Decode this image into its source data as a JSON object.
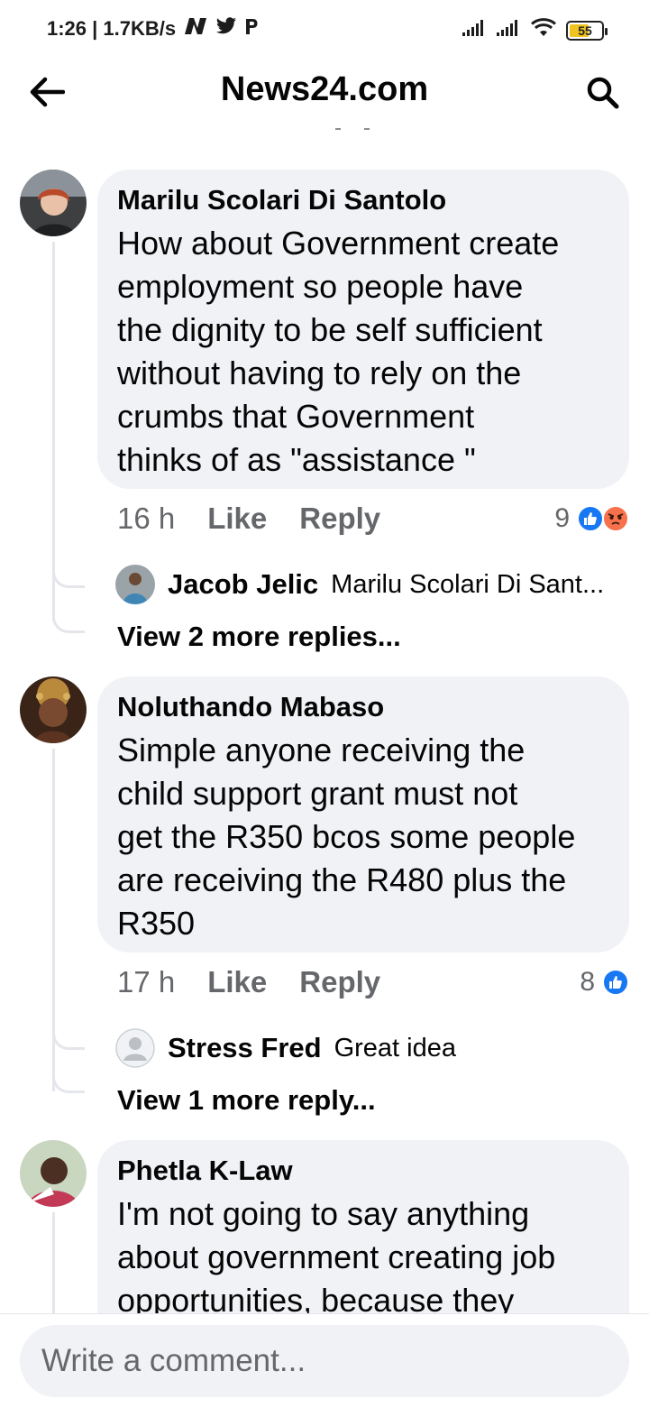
{
  "status_bar": {
    "time_speed": "1:26 | 1.7KB/s",
    "battery": "55",
    "app_icons": [
      "n-icon",
      "twitter-icon",
      "p-icon"
    ]
  },
  "header": {
    "title": "News24.com",
    "back_icon": "back-arrow-icon",
    "search_icon": "search-icon"
  },
  "comments": [
    {
      "author": "Marilu Scolari Di Santolo",
      "text": "How about Government  create\nemployment  so people have\nthe dignity to be self sufficient\nwithout  having to rely on the\ncrumbs that Government\nthinks of  as \"assistance \"",
      "time": "16 h",
      "like": "Like",
      "reply": "Reply",
      "reaction_count": "9",
      "reactions": [
        "like",
        "angry"
      ],
      "reply_preview": {
        "author": "Jacob Jelic",
        "text": "Marilu Scolari Di Sant..."
      },
      "more_replies": "View 2 more replies..."
    },
    {
      "author": "Noluthando Mabaso",
      "text": "Simple anyone receiving the\nchild support grant must not\nget the R350 bcos some people\nare receiving the R480 plus the\nR350",
      "time": "17 h",
      "like": "Like",
      "reply": "Reply",
      "reaction_count": "8",
      "reactions": [
        "like"
      ],
      "reply_preview": {
        "author": "Stress Fred",
        "text": "Great idea"
      },
      "more_replies": "View 1 more reply..."
    },
    {
      "author": "Phetla K-Law",
      "text": "I'm not going to say anything\nabout government creating job\nopportunities, because they"
    }
  ],
  "composer": {
    "placeholder": "Write a comment..."
  },
  "colors": {
    "accent": "#1877f2",
    "bubble": "#f0f2f5",
    "muted": "#65676b",
    "angry": "#f7714c"
  }
}
